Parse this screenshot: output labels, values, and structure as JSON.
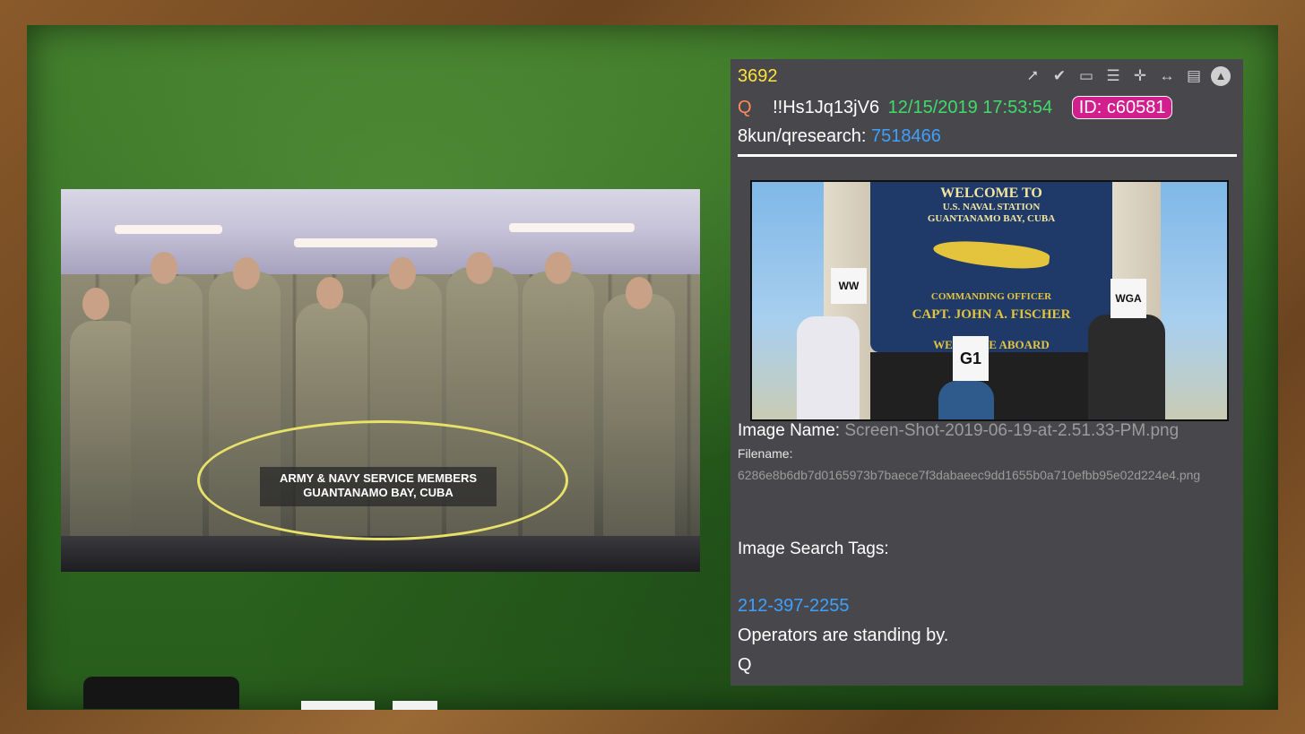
{
  "left_photo": {
    "caption_line1": "ARMY & NAVY SERVICE MEMBERS",
    "caption_line2": "GUANTANAMO BAY, CUBA",
    "highlight_color": "#e8e26a"
  },
  "post": {
    "number": "3692",
    "author": "Q",
    "tripcode": "!!Hs1Jq13jV6",
    "datetime": "12/15/2019 17:53:54",
    "id": "ID: c60581",
    "board_label": "8kun/qresearch:",
    "thread": "7518466",
    "toolbar_icons": [
      "share-icon",
      "clipboard-check-icon",
      "vr-icon",
      "document-icon",
      "move-icon",
      "resize-horizontal-icon",
      "clipboard-icon",
      "circle-a-icon"
    ],
    "image": {
      "sign_line1": "WELCOME TO",
      "sign_line2": "U.S. NAVAL STATION",
      "sign_line3": "GUANTANAMO BAY, CUBA",
      "sign_line4": "COMMANDING OFFICER",
      "sign_line5": "CAPT. JOHN A. FISCHER",
      "sign_line6": "WELCOME ABOARD",
      "card_ww": "WW",
      "card_wga": "WGA",
      "card_g1": "G1"
    },
    "image_name_label": "Image Name:",
    "image_name": "Screen-Shot-2019-06-19-at-2.51.33-PM.png",
    "filename_label": "Filename:",
    "filename": "6286e8b6db7d0165973b7baece7f3dabaeec9dd1655b0a710efbb95e02d224e4.png",
    "tags_label": "Image Search Tags:",
    "phone": "212-397-2255",
    "message": "Operators are standing by.",
    "signature": "Q"
  },
  "colors": {
    "post_number": "#ffe23a",
    "author": "#ff8a5c",
    "datetime": "#3fdc6a",
    "id_badge": "#d21f8d",
    "link": "#3da0ff",
    "panel_bg": "#48484c"
  }
}
